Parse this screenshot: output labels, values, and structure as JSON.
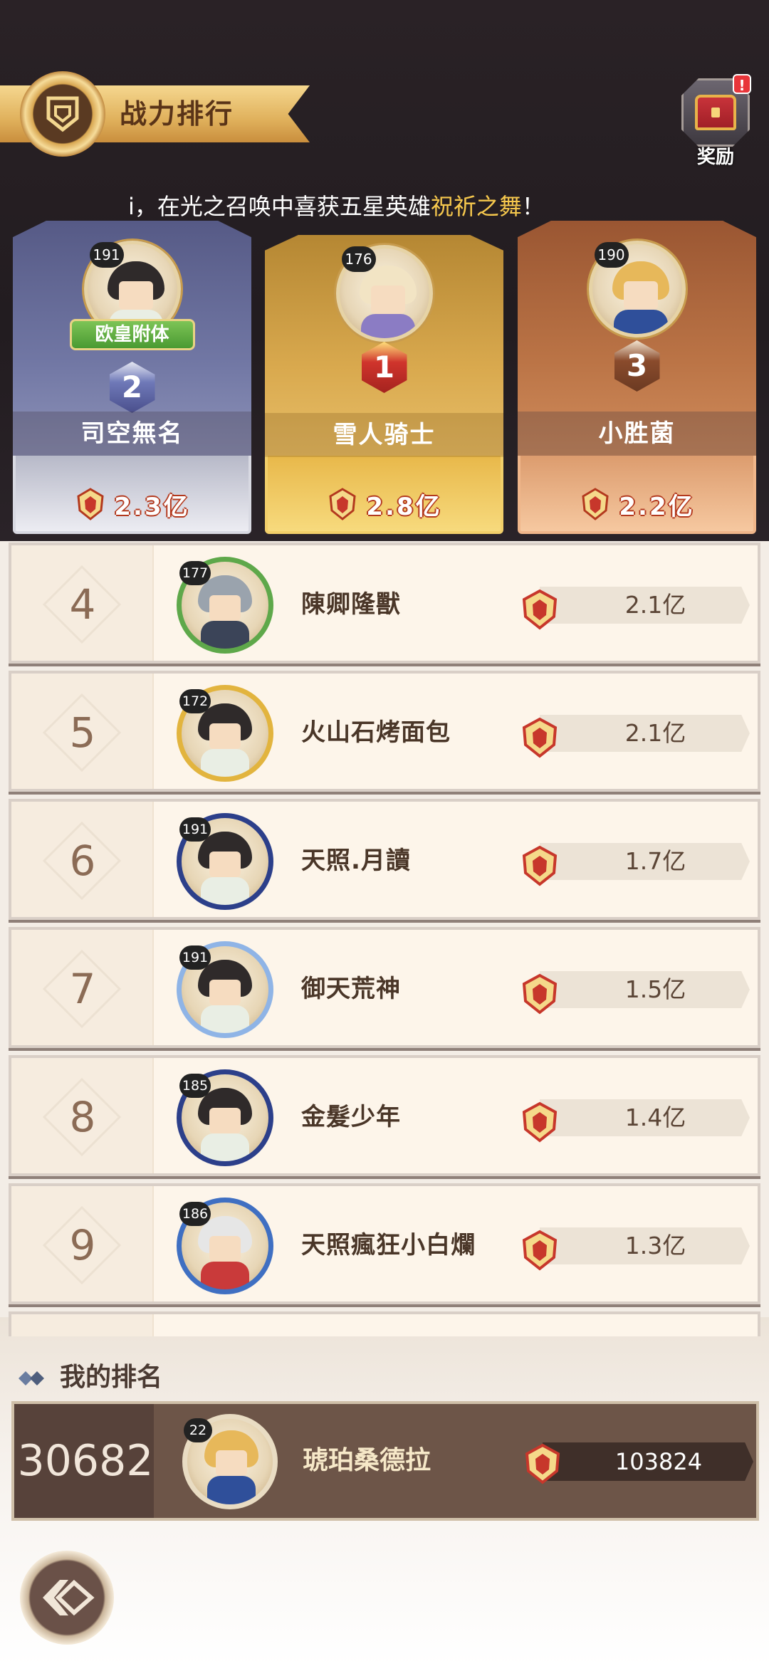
{
  "header": {
    "title": "战力排行",
    "reward_label": "奖励",
    "reward_badge": "!"
  },
  "marquee": {
    "prefix": "i，在光之召唤中喜获五星英雄",
    "highlight": "祝祈之舞",
    "suffix": "！"
  },
  "podium": {
    "first": {
      "rank": "1",
      "level": "176",
      "name": "雪人骑士",
      "power": "2.8亿"
    },
    "second": {
      "rank": "2",
      "level": "191",
      "name": "司空無名",
      "power": "2.3亿",
      "title": "欧皇附体"
    },
    "third": {
      "rank": "3",
      "level": "190",
      "name": "小胜菌",
      "power": "2.2亿"
    }
  },
  "ranking": [
    {
      "rank": "4",
      "level": "177",
      "name": "陳卿隆獸",
      "power": "2.1亿",
      "frame_color": "#5ea84a",
      "hair": "#9aa3ad",
      "body": "#3b4458"
    },
    {
      "rank": "5",
      "level": "172",
      "name": "火山石烤面包",
      "power": "2.1亿",
      "frame_color": "#e2b43e",
      "hair": "#2f2a2a",
      "body": "#e9eee4"
    },
    {
      "rank": "6",
      "level": "191",
      "name": "天照.月讀",
      "power": "1.7亿",
      "frame_color": "#2c3f8a",
      "hair": "#2f2a2a",
      "body": "#e9eee4"
    },
    {
      "rank": "7",
      "level": "191",
      "name": "御天荒神",
      "power": "1.5亿",
      "frame_color": "#8fb4e6",
      "hair": "#2f2a2a",
      "body": "#e9eee4"
    },
    {
      "rank": "8",
      "level": "185",
      "name": "金髮少年",
      "power": "1.4亿",
      "frame_color": "#2c3f8a",
      "hair": "#2f2a2a",
      "body": "#e9eee4"
    },
    {
      "rank": "9",
      "level": "186",
      "name": "天照瘋狂小白爛",
      "power": "1.3亿",
      "frame_color": "#3f6fc2",
      "hair": "#e6e6e6",
      "body": "#c93a3a"
    }
  ],
  "my_rank": {
    "label": "我的排名",
    "rank": "30682",
    "level": "22",
    "name": "琥珀桑德拉",
    "power": "103824"
  },
  "colors": {
    "accent_gold": "#f6c84d",
    "row_bg": "#fdf5ea",
    "my_row_bg": "#6d5548"
  },
  "icons": {
    "power": "power-crest-icon",
    "back": "back-arrow-icon",
    "reward": "treasure-chest-icon"
  }
}
